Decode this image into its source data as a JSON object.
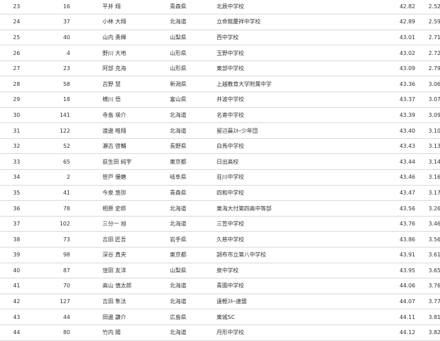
{
  "results": {
    "rows": [
      {
        "rank": "23",
        "bib": "16",
        "name": "平井 翔",
        "prefecture": "青森県",
        "team": "北辰中学校",
        "time": "42.82",
        "diff": "2.52"
      },
      {
        "rank": "24",
        "bib": "37",
        "name": "小林 大翔",
        "prefecture": "北海道",
        "team": "立命館慶祥中学校",
        "time": "42.89",
        "diff": "2.59"
      },
      {
        "rank": "25",
        "bib": "40",
        "name": "山内 勇輝",
        "prefecture": "山梨県",
        "team": "西中学校",
        "time": "43.01",
        "diff": "2.71"
      },
      {
        "rank": "26",
        "bib": "4",
        "name": "野川 大地",
        "prefecture": "山形県",
        "team": "玉野中学校",
        "time": "43.02",
        "diff": "2.72"
      },
      {
        "rank": "27",
        "bib": "23",
        "name": "阿部 克海",
        "prefecture": "山形県",
        "team": "東部中学校",
        "time": "43.09",
        "diff": "2.79"
      },
      {
        "rank": "28",
        "bib": "58",
        "name": "古野 慧",
        "prefecture": "新潟県",
        "team": "上越教育大学附属中学",
        "time": "43.36",
        "diff": "3.06"
      },
      {
        "rank": "29",
        "bib": "18",
        "name": "横川 悟",
        "prefecture": "富山県",
        "team": "井波中学校",
        "time": "43.37",
        "diff": "3.07"
      },
      {
        "rank": "30",
        "bib": "141",
        "name": "寺島 瑛介",
        "prefecture": "北海道",
        "team": "名寄中学校",
        "time": "43.39",
        "diff": "3.09"
      },
      {
        "rank": "31",
        "bib": "122",
        "name": "渡邊 唯翔",
        "prefecture": "北海道",
        "team": "留辺蘂ｽｷｰ少年団",
        "time": "43.40",
        "diff": "3.10"
      },
      {
        "rank": "32",
        "bib": "52",
        "name": "瀬古 啓輔",
        "prefecture": "長野県",
        "team": "白馬中学校",
        "time": "43.43",
        "diff": "3.13"
      },
      {
        "rank": "33",
        "bib": "65",
        "name": "荻生田 純宇",
        "prefecture": "東京都",
        "team": "日出高校",
        "time": "43.44",
        "diff": "3.14"
      },
      {
        "rank": "34",
        "bib": "2",
        "name": "笹戸 優磨",
        "prefecture": "岐阜県",
        "team": "荘川中学校",
        "time": "43.46",
        "diff": "3.16"
      },
      {
        "rank": "35",
        "bib": "41",
        "name": "今泉 悠弥",
        "prefecture": "青森県",
        "team": "四和中学校",
        "time": "43.47",
        "diff": "3.17"
      },
      {
        "rank": "36",
        "bib": "78",
        "name": "相原 史郎",
        "prefecture": "北海道",
        "team": "東海大付第四高中等部",
        "time": "43.56",
        "diff": "3.26"
      },
      {
        "rank": "37",
        "bib": "102",
        "name": "三分一 旭",
        "prefecture": "北海道",
        "team": "三笠中学校",
        "time": "43.76",
        "diff": "3.46"
      },
      {
        "rank": "38",
        "bib": "73",
        "name": "吉田 匠吾",
        "prefecture": "岩手県",
        "team": "久慈中学校",
        "time": "43.86",
        "diff": "3.56"
      },
      {
        "rank": "39",
        "bib": "98",
        "name": "深谷 真央",
        "prefecture": "東京都",
        "team": "調布市立第八中学校",
        "time": "43.91",
        "diff": "3.61"
      },
      {
        "rank": "40",
        "bib": "87",
        "name": "窪田 友洋",
        "prefecture": "山梨県",
        "team": "泉中学校",
        "time": "43.95",
        "diff": "3.65"
      },
      {
        "rank": "41",
        "bib": "70",
        "name": "高山 慎太郎",
        "prefecture": "北海道",
        "team": "青園中学校",
        "time": "44.06",
        "diff": "3.76"
      },
      {
        "rank": "42",
        "bib": "127",
        "name": "吉田 隼汰",
        "prefecture": "北海道",
        "team": "遠軽ｽｷｰ連盟",
        "time": "44.07",
        "diff": "3.77"
      },
      {
        "rank": "43",
        "bib": "44",
        "name": "田邊 謙介",
        "prefecture": "広島県",
        "team": "東城SC",
        "time": "44.11",
        "diff": "3.81"
      },
      {
        "rank": "44",
        "bib": "80",
        "name": "竹内 陽",
        "prefecture": "北海道",
        "team": "月形中学校",
        "time": "44.12",
        "diff": "3.82"
      }
    ]
  }
}
